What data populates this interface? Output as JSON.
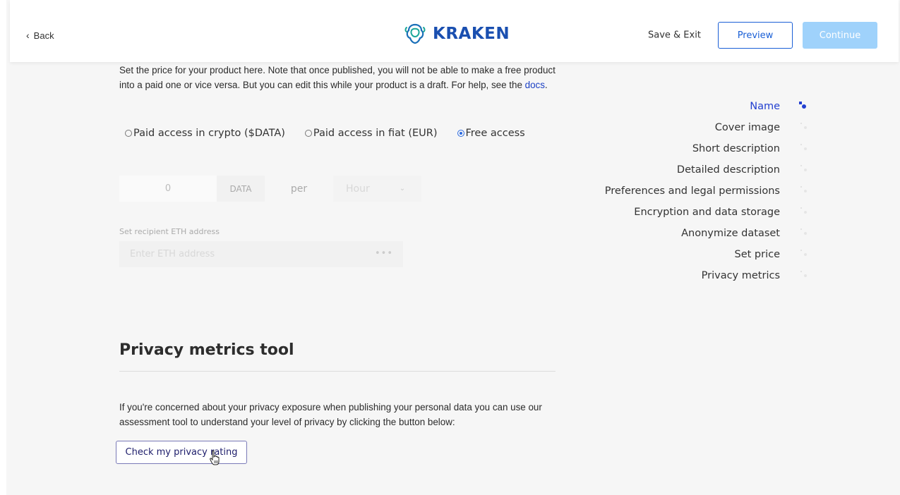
{
  "header": {
    "back_label": "Back",
    "logo_text": "KRAKEN",
    "save_exit_label": "Save & Exit",
    "preview_label": "Preview",
    "continue_label": "Continue"
  },
  "pricing": {
    "intro_part1": "Set the price for your product here. Note that once published, you will not be able to make a free product into a paid one or vice versa. But you can edit this while your product is a draft. For help, see the ",
    "docs_link": "docs",
    "intro_end": ".",
    "options": [
      {
        "label": "Paid access in crypto ($DATA)",
        "selected": false
      },
      {
        "label": "Paid access in fiat (EUR)",
        "selected": false
      },
      {
        "label": "Free access",
        "selected": true
      }
    ],
    "amount_value": "0",
    "currency": "DATA",
    "per_label": "per",
    "period_value": "Hour",
    "eth_label": "Set recipient ETH address",
    "eth_placeholder": "Enter ETH address",
    "eth_dots": "•••"
  },
  "privacy_tool": {
    "title": "Privacy metrics tool",
    "text": "If you're concerned about your privacy exposure when publishing your personal data you can use our assessment tool to understand your level of privacy by clicking the button below:",
    "button_label": "Check my privacy rating"
  },
  "steps": [
    {
      "label": "Name",
      "active": true
    },
    {
      "label": "Cover image",
      "active": false
    },
    {
      "label": "Short description",
      "active": false
    },
    {
      "label": "Detailed description",
      "active": false
    },
    {
      "label": "Preferences and legal permissions",
      "active": false
    },
    {
      "label": "Encryption and data storage",
      "active": false
    },
    {
      "label": "Anonymize dataset",
      "active": false
    },
    {
      "label": "Set price",
      "active": false
    },
    {
      "label": "Privacy metrics",
      "active": false
    }
  ],
  "colors": {
    "accent": "#2340d0",
    "preview_border": "#1a5fd6",
    "continue_bg": "#9fd2fb",
    "page_bg": "#f6f6f6"
  }
}
